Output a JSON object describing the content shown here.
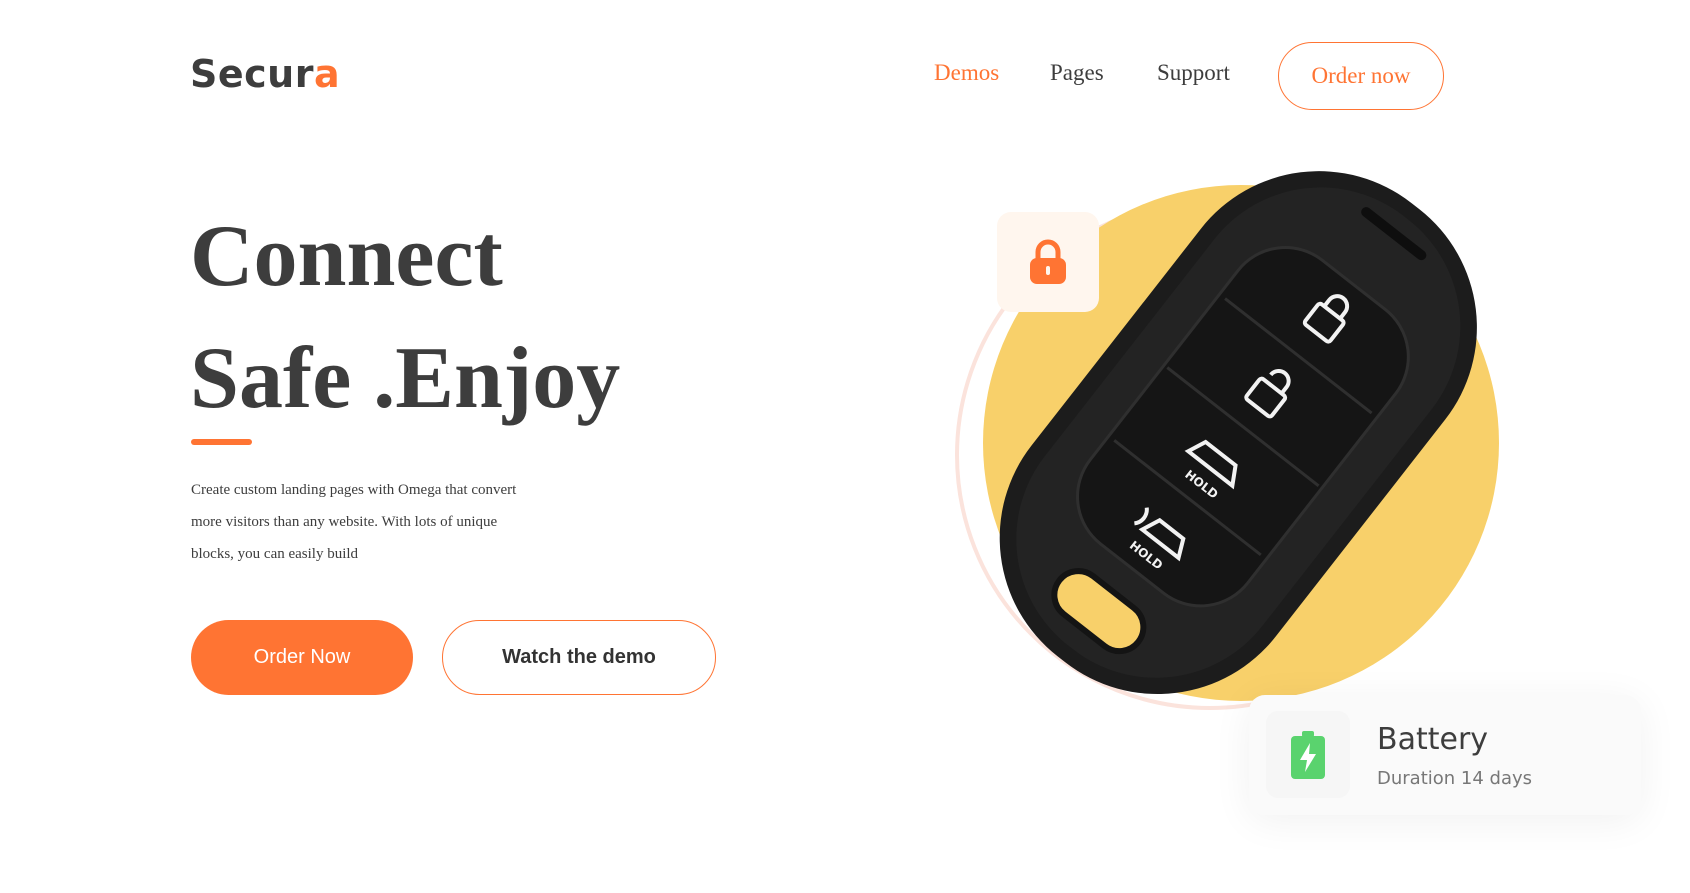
{
  "brand": {
    "name_main": "Secur",
    "name_accent": "a",
    "accent_color": "#ff7433"
  },
  "nav": {
    "items": [
      {
        "label": "Demos",
        "active": true
      },
      {
        "label": "Pages",
        "active": false
      },
      {
        "label": "Support",
        "active": false
      }
    ],
    "cta_label": "Order now"
  },
  "hero": {
    "headline_line1": "Connect",
    "headline_line2": "Safe .Enjoy",
    "description": "Create custom landing pages with Omega that convert more visitors than any website. With lots of unique blocks, you can easily build",
    "primary_button": "Order Now",
    "secondary_button": "Watch the demo"
  },
  "cards": {
    "lock": {
      "icon": "lock-icon"
    },
    "battery": {
      "icon": "battery-charging-icon",
      "title": "Battery",
      "subtitle": "Duration 14 days"
    }
  },
  "colors": {
    "accent": "#ff7433",
    "circle": "#f8d06a",
    "battery_green": "#5ad36e",
    "text": "#3d3d3d"
  }
}
